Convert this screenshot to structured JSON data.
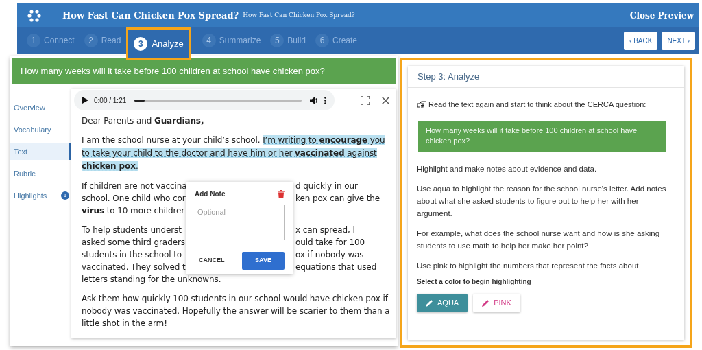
{
  "header": {
    "title": "How Fast Can Chicken Pox Spread?",
    "subtitle": "How Fast Can Chicken Pox Spread?",
    "close": "Close Preview"
  },
  "steps": [
    {
      "number": "1",
      "label": "Connect",
      "selected": false
    },
    {
      "number": "2",
      "label": "Read",
      "selected": false
    },
    {
      "number": "3",
      "label": "Analyze",
      "selected": true
    },
    {
      "number": "4",
      "label": "Summarize",
      "selected": false
    },
    {
      "number": "5",
      "label": "Build",
      "selected": false
    },
    {
      "number": "6",
      "label": "Create",
      "selected": false
    }
  ],
  "nav_buttons": [
    "‹ BACK",
    "NEXT ›"
  ],
  "question": "How many weeks will it take before 100 children at school have chicken pox?",
  "sidebar": [
    {
      "label": "Overview",
      "selected": false
    },
    {
      "label": "Vocabulary",
      "selected": false
    },
    {
      "label": "Text",
      "selected": true
    },
    {
      "label": "Rubric",
      "selected": false
    },
    {
      "label": "Highlights",
      "selected": false,
      "badge": "1"
    }
  ],
  "player": {
    "time": "0:00 / 1:21",
    "level": 0.06
  },
  "letter": [
    {
      "kind": "plain",
      "text": "Dear Parents and **Guardians,**"
    },
    {
      "kind": "segments",
      "segments": [
        {
          "text": "I am the school nurse at your child’s school. ",
          "highlighted": false
        },
        {
          "text": "I’m writing to **encourage** you to take your child to the doctor and have him or her **vaccinated** against **chicken pox**.",
          "highlighted": true
        }
      ]
    },
    {
      "kind": "covered",
      "lines": [
        [
          "If children are not vaccina",
          "d quickly in our"
        ],
        [
          "school. One child who cor",
          "ken pox can give the"
        ],
        [
          "**virus** to 10 more childrer"
        ]
      ]
    },
    {
      "kind": "covered",
      "lines": [
        [
          "To help students underst",
          "x can spread, I"
        ],
        [
          "asked some third graders",
          "ould take for 100"
        ],
        [
          "students in the school to",
          "ox if nobody was"
        ],
        [
          "vaccinated. They solved t",
          "equations that used"
        ],
        [
          "letters standing for the unknowns."
        ]
      ]
    },
    {
      "kind": "plain",
      "text": "Ask them how quickly 100 students in our school would have chicken pox if nobody was vaccinated. Hopefully the answer will be scarier to them than a little shot in the arm!"
    }
  ],
  "note_popup": {
    "title": "Add Note",
    "placeholder": "Optional",
    "cancel": "CANCEL",
    "save": "SAVE"
  },
  "step_panel": {
    "title": "Step 3: Analyze",
    "prompt": "Read the text again and start to think about the CERCA question:",
    "question": "How many weeks will it take before 100 children at school have chicken pox?",
    "paragraphs": [
      "Highlight and make notes about evidence and data.",
      "Use aqua to highlight the reason for the school nurse's letter. Add notes about what she asked students to figure out to help her with her argument.",
      "For example, what does the school nurse want and how is she asking students to use math to help her make her point?",
      "Use pink to highlight the numbers that represent the facts about"
    ],
    "color_label": "Select a color to begin highlighting",
    "colors": [
      {
        "label": "AQUA",
        "color": "#3e8f9b",
        "selected": true
      },
      {
        "label": "PINK",
        "color": "#d23a86",
        "selected": false
      }
    ]
  }
}
